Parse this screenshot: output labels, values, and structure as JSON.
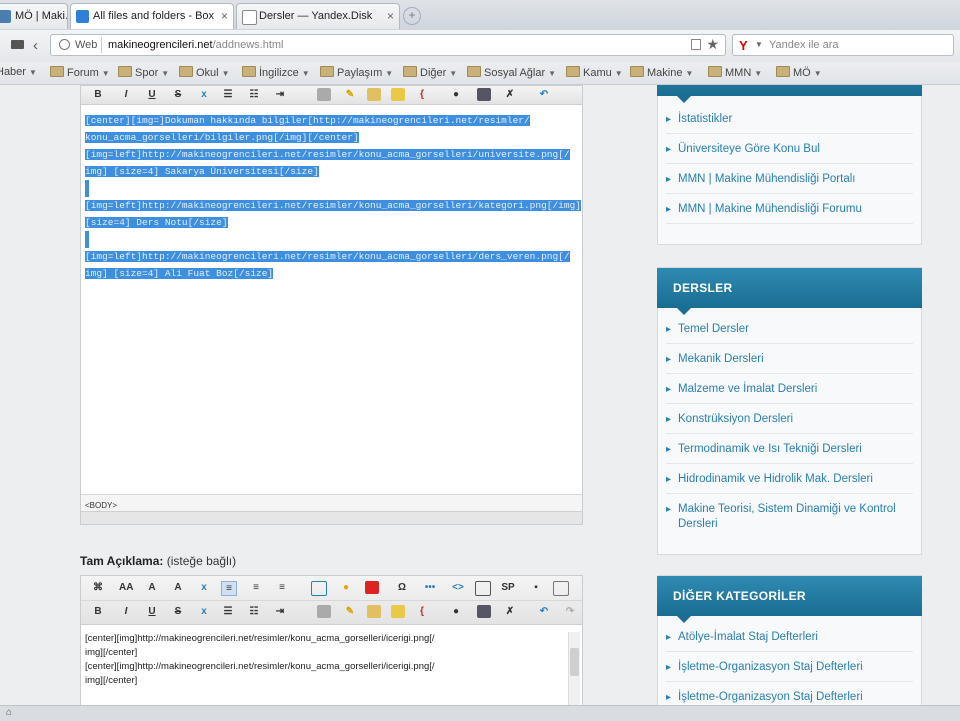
{
  "browser": {
    "tabs": [
      {
        "title": "MÖ | Maki…",
        "active": false,
        "icon": "site-icon"
      },
      {
        "title": "All files and folders - Box",
        "active": true,
        "icon": "box-icon"
      },
      {
        "title": "Dersler — Yandex.Disk",
        "active": false,
        "icon": "page-icon"
      }
    ],
    "url_scheme": "Web",
    "url_host": "makineogrencileri.net",
    "url_path": "/addnews.html",
    "search_placeholder": "Yandex ile ara",
    "bookmarks": [
      "Haber",
      "Forum",
      "Spor",
      "Okul",
      "İngilizce",
      "Paylaşım",
      "Diğer",
      "Sosyal Ağlar",
      "Kamu",
      "Makine",
      "MMN",
      "MÖ"
    ],
    "colors": {
      "accent": "#1a6d93",
      "link": "#2a7fb5",
      "selection": "#3f8fe0"
    }
  },
  "editor_short": {
    "lines": [
      "[center][img=]Dokuman hakkında bilgiler[http://makineogrencileri.net/resimler/",
      "konu_acma_gorselleri/bilgiler.png[/img][/center]",
      "[img=left]http://makineogrencileri.net/resimler/konu_acma_gorselleri/universite.png[/",
      "img]  [size=4] Sakarya Üniversitesi[/size]",
      "",
      "[img=left]http://makineogrencileri.net/resimler/konu_acma_gorselleri/kategori.png[/img]",
      "[size=4] Ders Notu[/size]",
      "",
      "[img=left]http://makineogrencileri.net/resimler/konu_acma_gorselleri/ders_veren.png[/",
      "img]  [size=4] Ali Fuat Boz[/size]"
    ],
    "status": "<BODY>"
  },
  "full_description": {
    "label": "Tam Açıklama:",
    "hint": "(isteğe bağlı)",
    "lines": [
      "[center][img]http://makineogrencileri.net/resimler/konu_acma_gorselleri/icerigi.png[/",
      "img][/center]",
      "[center][img]http://makineogrencileri.net/resimler/konu_acma_gorselleri/icerigi.png[/",
      "img][/center]"
    ]
  },
  "sidebar": {
    "box1": {
      "title": "",
      "items": [
        "İstatistikler",
        "Üniversiteye Göre Konu Bul",
        "MMN | Makine Mühendisliği Portalı",
        "MMN | Makine Mühendisliği Forumu"
      ]
    },
    "box2": {
      "title": "DERSLER",
      "items": [
        "Temel Dersler",
        "Mekanik Dersleri",
        "Malzeme ve İmalat Dersleri",
        "Konstrüksiyon Dersleri",
        "Termodinamik ve Isı Tekniği Dersleri",
        "Hidrodinamik ve Hidrolik Mak. Dersleri",
        "Makine Teorisi, Sistem Dinamiği ve Kontrol Dersleri"
      ]
    },
    "box3": {
      "title": "DİĞER KATEGORİLER",
      "items": [
        "Atölye-İmalat Staj Defterleri",
        "İşletme-Organizasyon Staj Defterleri",
        "İşletme-Organizasyon Staj Defterleri"
      ]
    }
  }
}
